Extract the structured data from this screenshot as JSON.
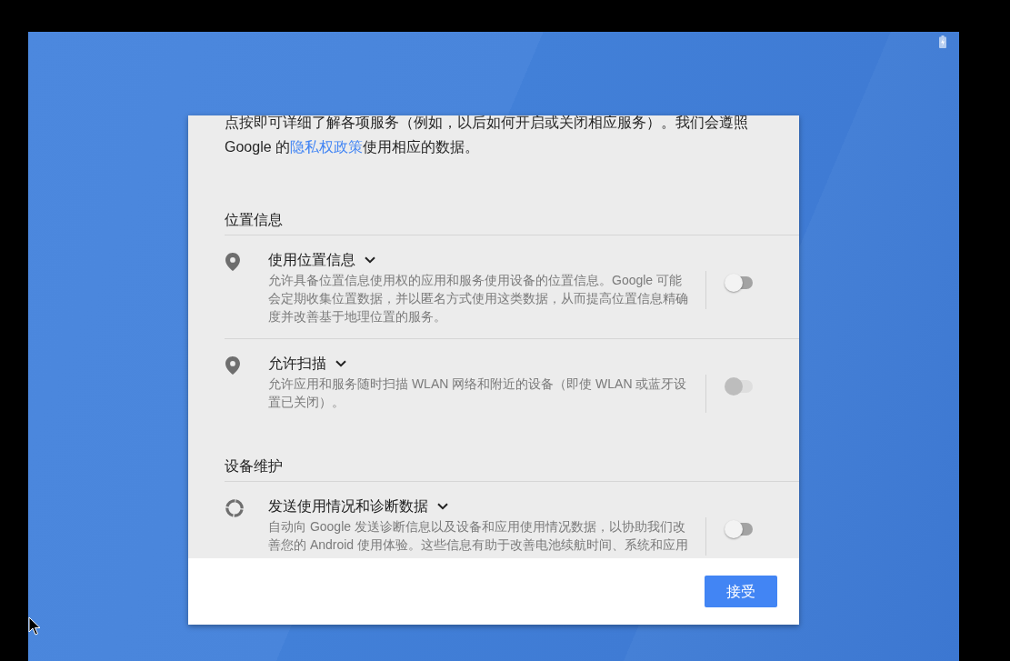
{
  "dialog": {
    "intro": {
      "text_before": "点按即可详细了解各项服务（例如，以后如何开启或关闭相应服务）。我们会遵照 Google 的",
      "link": "隐私权政策",
      "text_after": "使用相应的数据。"
    },
    "sections": [
      {
        "title": "位置信息",
        "items": [
          {
            "kind": "location",
            "title": "使用位置信息",
            "description": "允许具备位置信息使用权的应用和服务使用设备的位置信息。Google 可能会定期收集位置数据，并以匿名方式使用这类数据，从而提高位置信息精确度并改善基于地理位置的服务。",
            "on": false,
            "disabled": false
          },
          {
            "kind": "location",
            "title": "允许扫描",
            "description": "允许应用和服务随时扫描 WLAN 网络和附近的设备（即使 WLAN 或蓝牙设置已关闭）。",
            "on": false,
            "disabled": true
          }
        ]
      },
      {
        "title": "设备维护",
        "items": [
          {
            "kind": "diagnostics",
            "title": "发送使用情况和诊断数据",
            "description": "自动向 Google 发送诊断信息以及设备和应用使用情况数据，以协助我们改善您的 Android 使用体验。这些信息有助于改善电池续航时间、系统和应用",
            "on": false,
            "disabled": false
          }
        ]
      }
    ],
    "buttons": [
      {
        "label": "接受"
      }
    ]
  }
}
